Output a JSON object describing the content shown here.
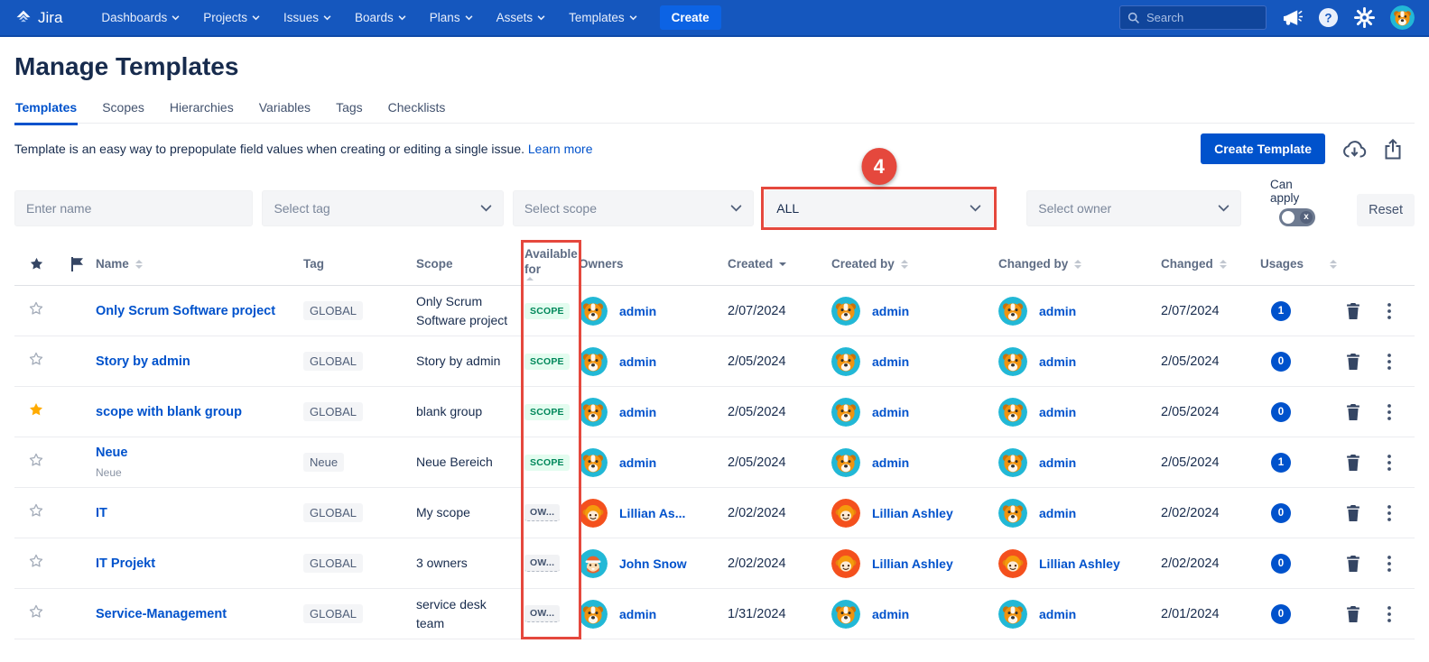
{
  "nav": {
    "brand": "Jira",
    "items": [
      {
        "label": "Dashboards"
      },
      {
        "label": "Projects"
      },
      {
        "label": "Issues"
      },
      {
        "label": "Boards"
      },
      {
        "label": "Plans"
      },
      {
        "label": "Assets"
      },
      {
        "label": "Templates"
      }
    ],
    "create_label": "Create",
    "search_placeholder": "Search"
  },
  "page": {
    "title": "Manage Templates",
    "tabs": [
      {
        "label": "Templates",
        "active": true
      },
      {
        "label": "Scopes",
        "active": false
      },
      {
        "label": "Hierarchies",
        "active": false
      },
      {
        "label": "Variables",
        "active": false
      },
      {
        "label": "Tags",
        "active": false
      },
      {
        "label": "Checklists",
        "active": false
      }
    ],
    "description": "Template is an easy way to prepopulate field values when creating or editing a single issue.",
    "learn_more": "Learn more"
  },
  "toolbar": {
    "create_template_label": "Create Template"
  },
  "filters": {
    "name_placeholder": "Enter name",
    "tag_placeholder": "Select tag",
    "scope_placeholder": "Select scope",
    "available_for_value": "ALL",
    "owner_placeholder": "Select owner",
    "can_apply_label": "Can apply",
    "reset_label": "Reset"
  },
  "annotation": {
    "badge_label": "4",
    "color": "#E5483D"
  },
  "table": {
    "columns": [
      {
        "label": "Name",
        "sort": "both"
      },
      {
        "label": "Tag",
        "sort": "none"
      },
      {
        "label": "Scope",
        "sort": "none"
      },
      {
        "label": "Available for",
        "sort": "both"
      },
      {
        "label": "Owners",
        "sort": "none"
      },
      {
        "label": "Created",
        "sort": "desc"
      },
      {
        "label": "Created by",
        "sort": "both"
      },
      {
        "label": "Changed by",
        "sort": "both"
      },
      {
        "label": "Changed",
        "sort": "both"
      },
      {
        "label": "Usages",
        "sort": "both"
      }
    ],
    "rows": [
      {
        "starred": false,
        "name": "Only Scrum Software project",
        "subtitle": "",
        "tag": "GLOBAL",
        "scope": "Only Scrum Software project",
        "available": {
          "label": "SCOPE",
          "type": "scope"
        },
        "owner": {
          "avatar": "dog",
          "name": "admin"
        },
        "created": "2/07/2024",
        "created_by": {
          "avatar": "dog",
          "name": "admin"
        },
        "changed_by": {
          "avatar": "dog",
          "name": "admin"
        },
        "changed": "2/07/2024",
        "usages": "1"
      },
      {
        "starred": false,
        "name": "Story by admin",
        "subtitle": "",
        "tag": "GLOBAL",
        "scope": "Story by admin",
        "available": {
          "label": "SCOPE",
          "type": "scope"
        },
        "owner": {
          "avatar": "dog",
          "name": "admin"
        },
        "created": "2/05/2024",
        "created_by": {
          "avatar": "dog",
          "name": "admin"
        },
        "changed_by": {
          "avatar": "dog",
          "name": "admin"
        },
        "changed": "2/05/2024",
        "usages": "0"
      },
      {
        "starred": true,
        "name": "scope with blank group",
        "subtitle": "",
        "tag": "GLOBAL",
        "scope": "blank group",
        "available": {
          "label": "SCOPE",
          "type": "scope"
        },
        "owner": {
          "avatar": "dog",
          "name": "admin"
        },
        "created": "2/05/2024",
        "created_by": {
          "avatar": "dog",
          "name": "admin"
        },
        "changed_by": {
          "avatar": "dog",
          "name": "admin"
        },
        "changed": "2/05/2024",
        "usages": "0"
      },
      {
        "starred": false,
        "name": "Neue",
        "subtitle": "Neue",
        "tag": "Neue",
        "scope": "Neue Bereich",
        "available": {
          "label": "SCOPE",
          "type": "scope"
        },
        "owner": {
          "avatar": "dog",
          "name": "admin"
        },
        "created": "2/05/2024",
        "created_by": {
          "avatar": "dog",
          "name": "admin"
        },
        "changed_by": {
          "avatar": "dog",
          "name": "admin"
        },
        "changed": "2/05/2024",
        "usages": "1"
      },
      {
        "starred": false,
        "name": "IT",
        "subtitle": "",
        "tag": "GLOBAL",
        "scope": "My scope",
        "available": {
          "label": "OW...",
          "type": "owner"
        },
        "owner": {
          "avatar": "girl",
          "name": "Lillian As..."
        },
        "created": "2/02/2024",
        "created_by": {
          "avatar": "girl",
          "name": "Lillian Ashley"
        },
        "changed_by": {
          "avatar": "dog",
          "name": "admin"
        },
        "changed": "2/02/2024",
        "usages": "0"
      },
      {
        "starred": false,
        "name": "IT Projekt",
        "subtitle": "",
        "tag": "GLOBAL",
        "scope": "3 owners",
        "available": {
          "label": "OW...",
          "type": "owner"
        },
        "owner": {
          "avatar": "hatguy",
          "name": "John Snow"
        },
        "created": "2/02/2024",
        "created_by": {
          "avatar": "girl",
          "name": "Lillian Ashley"
        },
        "changed_by": {
          "avatar": "girl",
          "name": "Lillian Ashley"
        },
        "changed": "2/02/2024",
        "usages": "0"
      },
      {
        "starred": false,
        "name": "Service-Management",
        "subtitle": "",
        "tag": "GLOBAL",
        "scope": "service desk team",
        "available": {
          "label": "OW...",
          "type": "owner"
        },
        "owner": {
          "avatar": "dog",
          "name": "admin"
        },
        "created": "1/31/2024",
        "created_by": {
          "avatar": "dog",
          "name": "admin"
        },
        "changed_by": {
          "avatar": "dog",
          "name": "admin"
        },
        "changed": "2/01/2024",
        "usages": "0"
      }
    ]
  }
}
